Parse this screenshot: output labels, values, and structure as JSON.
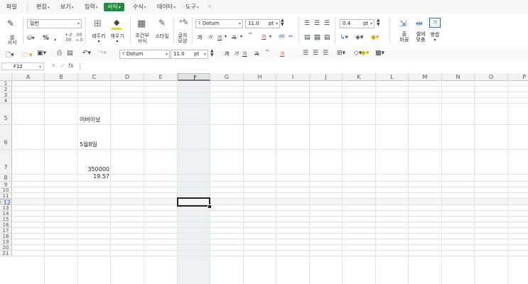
{
  "menu": {
    "items": [
      "파일",
      "편집",
      "보기",
      "입력",
      "서식",
      "수식",
      "데이터",
      "도구"
    ],
    "active": "서식"
  },
  "ribbon": {
    "cell_format": "셀\n서식",
    "number_format": "일반",
    "percent": "%",
    "comma": ",",
    "border": "테두리",
    "fill": "채우기",
    "conditional": "조건부\n서식",
    "style": "스타일",
    "text_shape": "글자\n모양",
    "font": "Dotum",
    "size": "11.0",
    "unit": "pt",
    "bold_chars": [
      "가",
      "가",
      "가",
      "가",
      "가"
    ],
    "line_width": "0.4",
    "line_unit": "pt",
    "wrap": "줄\n바꿈",
    "fit": "셀에\n맞춤",
    "merge": "병합",
    "merge_icon": "가"
  },
  "toolbar2": {
    "font": "Dotum",
    "size": "11.0",
    "unit": "pt",
    "chars": [
      "가",
      "가",
      "가",
      "가",
      "가"
    ]
  },
  "formula_bar": {
    "name_box": "F12",
    "fx": "fx"
  },
  "grid": {
    "columns": [
      "A",
      "B",
      "C",
      "D",
      "E",
      "F",
      "G",
      "H",
      "I",
      "J",
      "K",
      "L",
      "M",
      "N",
      "O",
      "P"
    ],
    "selected_column": "F",
    "rows": [
      "1",
      "2",
      "3",
      "4",
      "5",
      "6",
      "7",
      "8",
      "9",
      "10",
      "11",
      "12",
      "13",
      "14",
      "15",
      "16",
      "17",
      "18",
      "19",
      "20",
      "21"
    ],
    "selected_row": "12",
    "cells": {
      "C5": "어버이날",
      "C6": "5월8일",
      "C7": "350000",
      "C8": "19.57"
    }
  }
}
